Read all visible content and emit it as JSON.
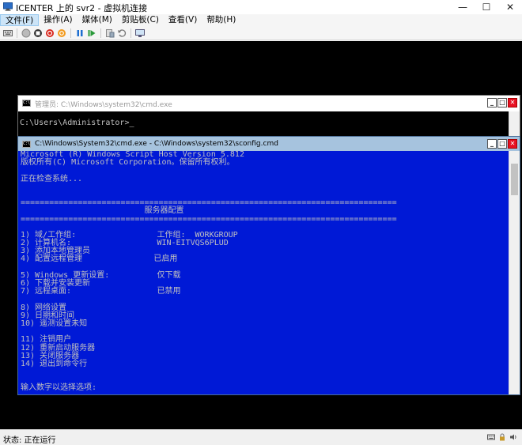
{
  "window": {
    "title": "ICENTER 上的 svr2 - 虚拟机连接",
    "min": "—",
    "max": "☐",
    "close": "✕"
  },
  "menu": [
    "文件(F)",
    "操作(A)",
    "媒体(M)",
    "剪贴板(C)",
    "查看(V)",
    "帮助(H)"
  ],
  "admin_cmd": {
    "title": "管理员: C:\\Windows\\system32\\cmd.exe",
    "prompt": "C:\\Users\\Administrator>"
  },
  "sconfig": {
    "title": "C:\\Windows\\System32\\cmd.exe - C:\\Windows\\system32\\sconfig.cmd",
    "lines": [
      "Microsoft (R) Windows Script Host Version 5.812",
      "版权所有(C) Microsoft Corporation。保留所有权利。",
      "",
      "正在检查系统...",
      "",
      "",
      "===============================================================================",
      "                          服务器配置",
      "===============================================================================",
      "",
      "1) 域/工作组:                 工作组:  WORKGROUP",
      "2) 计算机名:                  WIN-EITVQS6PLUD",
      "3) 添加本地管理员",
      "4) 配置远程管理               已启用",
      "",
      "5) Windows 更新设置:          仅下载",
      "6) 下载并安装更新",
      "7) 远程桌面:                  已禁用",
      "",
      "8) 网络设置",
      "9) 日期和时间",
      "10) 遥测设置未知",
      "",
      "11) 注销用户",
      "12) 重新启动服务器",
      "13) 关闭服务器",
      "14) 退出到命令行",
      "",
      "",
      "输入数字以选择选项:"
    ]
  },
  "status": {
    "text": "状态: 正在运行"
  }
}
